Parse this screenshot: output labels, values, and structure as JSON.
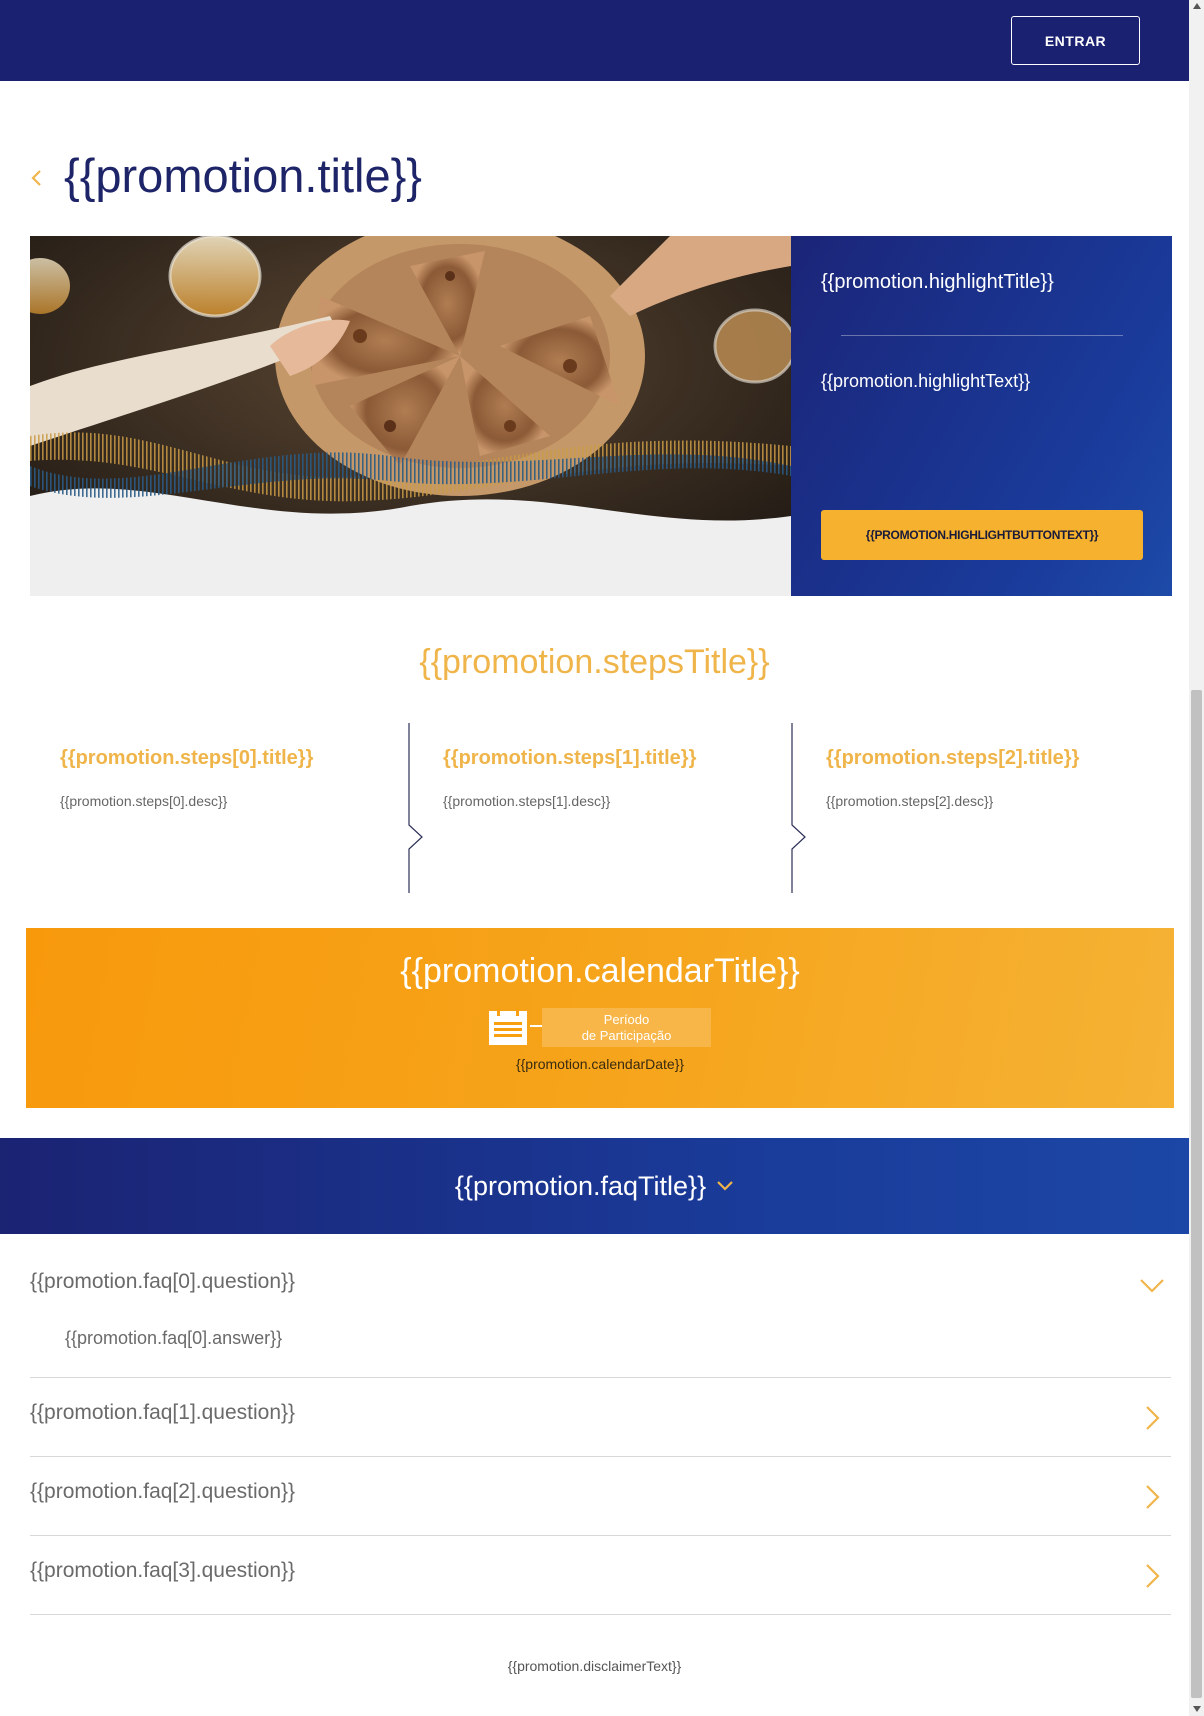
{
  "header": {
    "login_label": "ENTRAR"
  },
  "promotion": {
    "title": "{{promotion.title}}",
    "highlight": {
      "title": "{{promotion.highlightTitle}}",
      "text": "{{promotion.highlightText}}",
      "button_label": "{{PROMOTION.HIGHLIGHTBUTTONTEXT}}"
    },
    "steps_title": "{{promotion.stepsTitle}}",
    "steps": [
      {
        "title": "{{promotion.steps[0].title}}",
        "desc": "{{promotion.steps[0].desc}}"
      },
      {
        "title": "{{promotion.steps[1].title}}",
        "desc": "{{promotion.steps[1].desc}}"
      },
      {
        "title": "{{promotion.steps[2].title}}",
        "desc": "{{promotion.steps[2].desc}}"
      }
    ],
    "calendar": {
      "title": "{{promotion.calendarTitle}}",
      "badge_line1": "Período",
      "badge_line2": "de Participação",
      "date": "{{promotion.calendarDate}}"
    },
    "faq_title": "{{promotion.faqTitle}}",
    "faq": [
      {
        "question": "{{promotion.faq[0].question}}",
        "answer": "{{promotion.faq[0].answer}}",
        "expanded": true
      },
      {
        "question": "{{promotion.faq[1].question}}",
        "expanded": false
      },
      {
        "question": "{{promotion.faq[2].question}}",
        "expanded": false
      },
      {
        "question": "{{promotion.faq[3].question}}",
        "expanded": false
      }
    ],
    "disclaimer": "{{promotion.disclaimerText}}"
  },
  "colors": {
    "navy": "#1a2170",
    "accent_gold": "#f0b54a",
    "button_yellow": "#f6b22e",
    "calendar_orange": "#f8990c"
  },
  "icons": {
    "back": "chevron-left-icon",
    "faq_header": "chevron-down-icon",
    "faq_expanded": "chevron-down-icon",
    "faq_collapsed": "chevron-right-icon",
    "calendar": "calendar-icon"
  }
}
